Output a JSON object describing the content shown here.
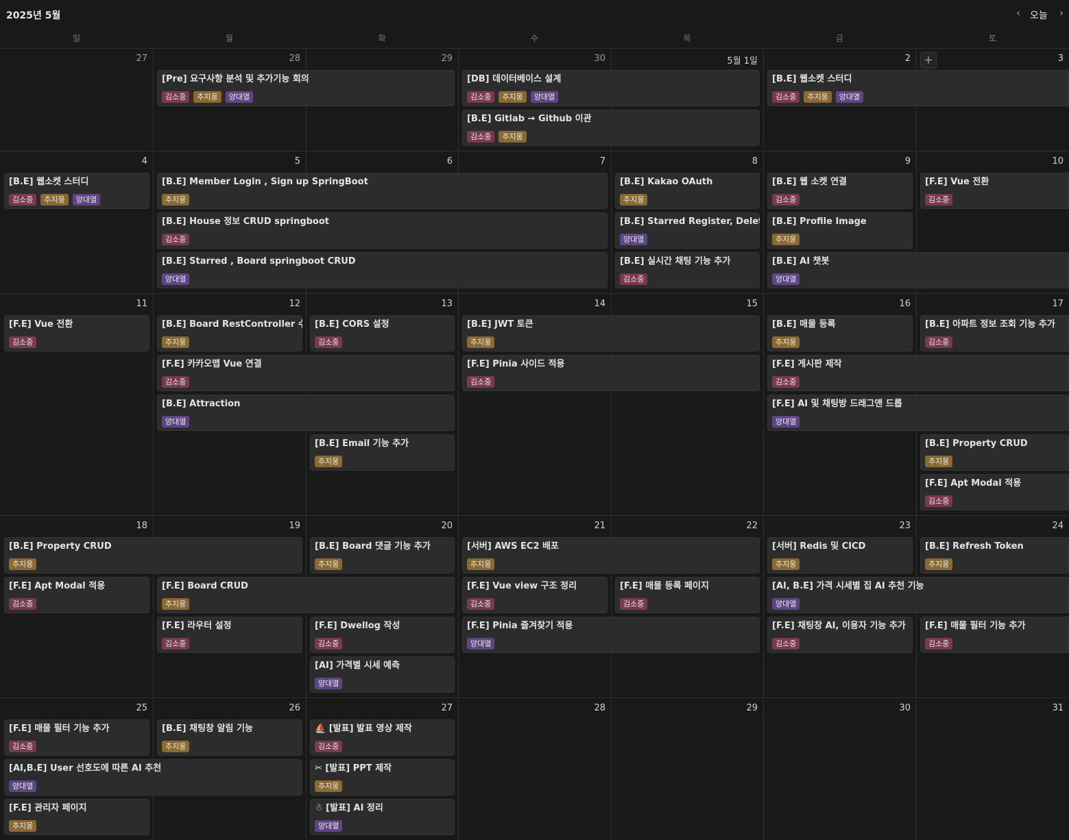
{
  "header": {
    "title": "2025년 5월",
    "prev_icon": "‹",
    "today_label": "오늘",
    "next_icon": "›"
  },
  "weekdays": [
    "일",
    "월",
    "화",
    "수",
    "목",
    "금",
    "토"
  ],
  "colors": {
    "김소중": "#7a3a4e",
    "추지웅": "#8a6a32",
    "양대열": "#5e4583"
  },
  "add_icon": "+",
  "weeks": [
    {
      "days": [
        "27",
        "28",
        "29",
        "30",
        "5월 1일",
        "2",
        "3"
      ]
    },
    {
      "days": [
        "4",
        "5",
        "6",
        "7",
        "8",
        "9",
        "10"
      ]
    },
    {
      "days": [
        "11",
        "12",
        "13",
        "14",
        "15",
        "16",
        "17"
      ]
    },
    {
      "days": [
        "18",
        "19",
        "20",
        "21",
        "22",
        "23",
        "24"
      ]
    },
    {
      "days": [
        "25",
        "26",
        "27",
        "28",
        "29",
        "30",
        "31"
      ]
    }
  ],
  "events": [
    {
      "week": 0,
      "start": 1,
      "span": 2,
      "row": 0,
      "title": "[Pre] 요구사항 분석 및 추가기능 회의",
      "tags": [
        "김소중",
        "추지웅",
        "양대열"
      ]
    },
    {
      "week": 0,
      "start": 3,
      "span": 2,
      "row": 0,
      "title": "[DB] 데이터베이스 설계",
      "tags": [
        "김소중",
        "추지웅",
        "양대열"
      ]
    },
    {
      "week": 0,
      "start": 3,
      "span": 2,
      "row": 1,
      "title": "[B.E] Gitlab → Github 이관",
      "tags": [
        "김소중",
        "추지웅"
      ]
    },
    {
      "week": 0,
      "start": 5,
      "span": 2,
      "row": 0,
      "title": "[B.E] 웹소켓 스터디",
      "tags": [
        "김소중",
        "추지웅",
        "양대열"
      ]
    },
    {
      "week": 1,
      "start": 0,
      "span": 1,
      "row": 0,
      "title": "[B.E] 웹소켓 스터디",
      "tags": [
        "김소중",
        "추지웅",
        "양대열"
      ]
    },
    {
      "week": 1,
      "start": 1,
      "span": 3,
      "row": 0,
      "title": "[B.E] Member Login , Sign up SpringBoot",
      "tags": [
        "추지웅"
      ]
    },
    {
      "week": 1,
      "start": 1,
      "span": 3,
      "row": 1,
      "title": "[B.E] House 정보 CRUD springboot",
      "tags": [
        "김소중"
      ]
    },
    {
      "week": 1,
      "start": 1,
      "span": 3,
      "row": 2,
      "title": "[B.E] Starred , Board springboot CRUD",
      "tags": [
        "양대열"
      ]
    },
    {
      "week": 1,
      "start": 4,
      "span": 1,
      "row": 0,
      "title": "[B.E] Kakao OAuth",
      "tags": [
        "추지웅"
      ]
    },
    {
      "week": 1,
      "start": 4,
      "span": 1,
      "row": 1,
      "title": "[B.E] Starred Register, Delete",
      "tags": [
        "양대열"
      ]
    },
    {
      "week": 1,
      "start": 4,
      "span": 1,
      "row": 2,
      "title": "[B.E] 실시간 채팅 기능 추가",
      "tags": [
        "김소중"
      ]
    },
    {
      "week": 1,
      "start": 5,
      "span": 1,
      "row": 0,
      "title": "[B.E] 웹 소켓 연결",
      "tags": [
        "김소중"
      ]
    },
    {
      "week": 1,
      "start": 5,
      "span": 1,
      "row": 1,
      "title": "[B.E] Profile Image",
      "tags": [
        "추지웅"
      ]
    },
    {
      "week": 1,
      "start": 5,
      "span": 2,
      "row": 2,
      "title": "[B.E] AI 챗봇",
      "tags": [
        "양대열"
      ]
    },
    {
      "week": 1,
      "start": 6,
      "span": 1,
      "row": 0,
      "title": "[F.E] Vue 전환",
      "tags": [
        "김소중"
      ]
    },
    {
      "week": 2,
      "start": 0,
      "span": 1,
      "row": 0,
      "title": "[F.E] Vue 전환",
      "tags": [
        "김소중"
      ]
    },
    {
      "week": 2,
      "start": 1,
      "span": 1,
      "row": 0,
      "title": "[B.E] Board RestController 수정",
      "tags": [
        "추지웅"
      ]
    },
    {
      "week": 2,
      "start": 2,
      "span": 1,
      "row": 0,
      "title": "[B.E] CORS 설정",
      "tags": [
        "김소중"
      ]
    },
    {
      "week": 2,
      "start": 3,
      "span": 2,
      "row": 0,
      "title": "[B.E] JWT 토큰",
      "tags": [
        "추지웅"
      ]
    },
    {
      "week": 2,
      "start": 5,
      "span": 1,
      "row": 0,
      "title": "[B.E] 매물 등록",
      "tags": [
        "추지웅"
      ]
    },
    {
      "week": 2,
      "start": 6,
      "span": 1,
      "row": 0,
      "title": "[B.E] 아파트 정보 조회 기능 추가",
      "tags": [
        "김소중"
      ]
    },
    {
      "week": 2,
      "start": 1,
      "span": 2,
      "row": 1,
      "title": "[F.E] 카카오맵 Vue 연결",
      "tags": [
        "김소중"
      ]
    },
    {
      "week": 2,
      "start": 3,
      "span": 2,
      "row": 1,
      "title": "[F.E] Pinia 사이드 적용",
      "tags": [
        "김소중"
      ]
    },
    {
      "week": 2,
      "start": 5,
      "span": 2,
      "row": 1,
      "title": "[F.E] 게시판 제작",
      "tags": [
        "김소중"
      ]
    },
    {
      "week": 2,
      "start": 1,
      "span": 2,
      "row": 2,
      "title": "[B.E] Attraction",
      "tags": [
        "양대열"
      ]
    },
    {
      "week": 2,
      "start": 5,
      "span": 2,
      "row": 2,
      "title": "[F.E] AI 및 채팅방 드래그앤 드롭",
      "tags": [
        "양대열"
      ]
    },
    {
      "week": 2,
      "start": 2,
      "span": 1,
      "row": 3,
      "title": "[B.E] Email 기능 추가",
      "tags": [
        "추지웅"
      ]
    },
    {
      "week": 2,
      "start": 6,
      "span": 1,
      "row": 3,
      "title": "[B.E] Property CRUD",
      "tags": [
        "추지웅"
      ]
    },
    {
      "week": 2,
      "start": 6,
      "span": 1,
      "row": 4,
      "title": "[F.E] Apt Modal 적용",
      "tags": [
        "김소중"
      ]
    },
    {
      "week": 3,
      "start": 0,
      "span": 2,
      "row": 0,
      "title": "[B.E] Property CRUD",
      "tags": [
        "추지웅"
      ]
    },
    {
      "week": 3,
      "start": 2,
      "span": 1,
      "row": 0,
      "title": "[B.E] Board 댓글 기능 추가",
      "tags": [
        "추지웅"
      ]
    },
    {
      "week": 3,
      "start": 3,
      "span": 2,
      "row": 0,
      "title": "[서버] AWS EC2 배포",
      "tags": [
        "추지웅"
      ]
    },
    {
      "week": 3,
      "start": 5,
      "span": 1,
      "row": 0,
      "title": "[서버] Redis 및 CICD",
      "tags": [
        "추지웅"
      ]
    },
    {
      "week": 3,
      "start": 6,
      "span": 1,
      "row": 0,
      "title": "[B.E] Refresh Token",
      "tags": [
        "추지웅"
      ]
    },
    {
      "week": 3,
      "start": 0,
      "span": 1,
      "row": 1,
      "title": "[F.E] Apt Modal 적용",
      "tags": [
        "김소중"
      ]
    },
    {
      "week": 3,
      "start": 1,
      "span": 2,
      "row": 1,
      "title": "[F.E] Board CRUD",
      "tags": [
        "추지웅"
      ]
    },
    {
      "week": 3,
      "start": 3,
      "span": 1,
      "row": 1,
      "title": "[F.E] Vue view 구조 정리",
      "tags": [
        "김소중"
      ]
    },
    {
      "week": 3,
      "start": 4,
      "span": 1,
      "row": 1,
      "title": "[F.E] 매물 등록 페이지",
      "tags": [
        "김소중"
      ]
    },
    {
      "week": 3,
      "start": 5,
      "span": 2,
      "row": 1,
      "title": "[AI, B.E] 가격 시세별 집 AI 추천 기능",
      "tags": [
        "양대열"
      ]
    },
    {
      "week": 3,
      "start": 1,
      "span": 1,
      "row": 2,
      "title": "[F.E] 라우터 설정",
      "tags": [
        "김소중"
      ]
    },
    {
      "week": 3,
      "start": 2,
      "span": 1,
      "row": 2,
      "title": "[F.E] Dwellog 작성",
      "tags": [
        "김소중"
      ]
    },
    {
      "week": 3,
      "start": 3,
      "span": 2,
      "row": 2,
      "title": "[F.E] Pinia 즐겨찾기 적용",
      "tags": [
        "양대열"
      ]
    },
    {
      "week": 3,
      "start": 5,
      "span": 1,
      "row": 2,
      "title": "[F.E] 채팅창 AI, 이용자 기능 추가",
      "tags": [
        "김소중"
      ]
    },
    {
      "week": 3,
      "start": 6,
      "span": 1,
      "row": 2,
      "title": "[F.E] 매물 필터 기능 추가",
      "tags": [
        "김소중"
      ]
    },
    {
      "week": 3,
      "start": 2,
      "span": 1,
      "row": 3,
      "title": "[AI] 가격별 시세 예측",
      "tags": [
        "양대열"
      ]
    },
    {
      "week": 4,
      "start": 0,
      "span": 1,
      "row": 0,
      "title": "[F.E] 매물 필터 기능 추가",
      "tags": [
        "김소중"
      ]
    },
    {
      "week": 4,
      "start": 1,
      "span": 1,
      "row": 0,
      "title": "[B.E] 채팅창 알림 기능",
      "tags": [
        "추지웅"
      ]
    },
    {
      "week": 4,
      "start": 2,
      "span": 1,
      "row": 0,
      "title": "⛵ [발표] 발표 영상 제작",
      "tags": [
        "김소중"
      ]
    },
    {
      "week": 4,
      "start": 0,
      "span": 2,
      "row": 1,
      "title": "[AI,B.E] User 선호도에 따른 AI 추천",
      "tags": [
        "양대열"
      ]
    },
    {
      "week": 4,
      "start": 2,
      "span": 1,
      "row": 1,
      "title": "✂ [발표] PPT 제작",
      "tags": [
        "추지웅"
      ]
    },
    {
      "week": 4,
      "start": 0,
      "span": 1,
      "row": 2,
      "title": "[F.E] 관리자 페이지",
      "tags": [
        "추지웅"
      ]
    },
    {
      "week": 4,
      "start": 2,
      "span": 1,
      "row": 2,
      "title": "☃ [발표] AI 정리",
      "tags": [
        "양대열"
      ]
    }
  ]
}
